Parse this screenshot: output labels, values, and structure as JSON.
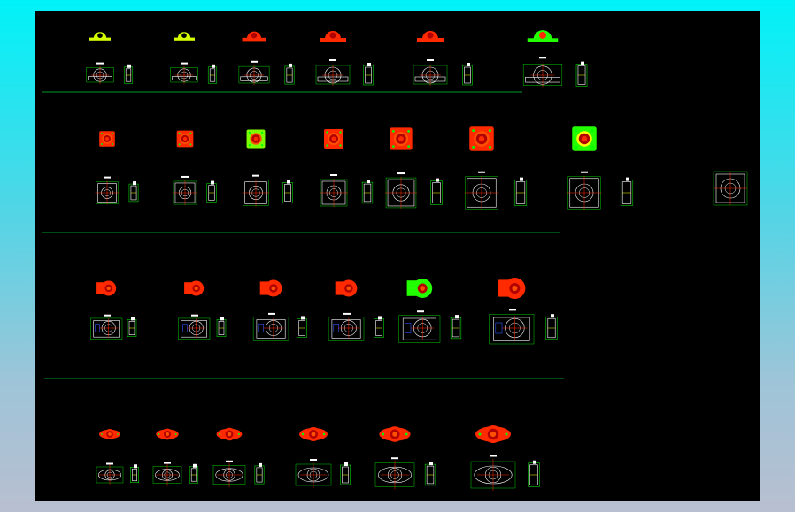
{
  "drawing": {
    "background": "#000000",
    "colors": {
      "red": "#ff2a00",
      "dark_red": "#b00000",
      "green": "#00ff00",
      "yellow_green": "#d4ff00",
      "lime": "#7cff00",
      "white": "#ffffff",
      "yellow": "#ffff00",
      "magenta": "#ff00ff",
      "blue": "#3355ff",
      "rule": "#00cc33"
    },
    "rows": [
      {
        "name": "pillow-block-row",
        "kind": "pillow",
        "items": [
          {
            "body_color": "#d4ff00",
            "bore_color": "#000000",
            "scale": 0.8
          },
          {
            "body_color": "#d4ff00",
            "bore_color": "#000000",
            "scale": 0.8
          },
          {
            "body_color": "#ff2a00",
            "bore_color": "#b00000",
            "scale": 0.9
          },
          {
            "body_color": "#ff2a00",
            "bore_color": "#b00000",
            "scale": 1.0
          },
          {
            "body_color": "#ff2a00",
            "bore_color": "#b00000",
            "scale": 1.0
          },
          {
            "body_color": "#22ff00",
            "bore_color": "#ff2a00",
            "scale": 1.15
          }
        ]
      },
      {
        "name": "square-flange-row",
        "kind": "square",
        "items": [
          {
            "body_color": "#ff2a00",
            "inner_color": "#ffcc00",
            "scale": 0.8
          },
          {
            "body_color": "#ff2a00",
            "inner_color": "#ffcc00",
            "scale": 0.85
          },
          {
            "body_color": "#7cff00",
            "inner_color": "#ff2a00",
            "scale": 0.95
          },
          {
            "body_color": "#ff2a00",
            "inner_color": "#ffcc00",
            "scale": 1.0
          },
          {
            "body_color": "#ff2a00",
            "inner_color": "#ff2a00",
            "scale": 1.15
          },
          {
            "body_color": "#ff2a00",
            "inner_color": "#ff2a00",
            "scale": 1.25
          },
          {
            "body_color": "#22ff00",
            "inner_color": "#ffff00",
            "scale": 1.25
          }
        ]
      },
      {
        "name": "take-up-row",
        "kind": "takeup",
        "items": [
          {
            "body_color": "#ff2a00",
            "scale": 0.85
          },
          {
            "body_color": "#ff2a00",
            "scale": 0.85
          },
          {
            "body_color": "#ff2a00",
            "scale": 0.95
          },
          {
            "body_color": "#ff2a00",
            "scale": 0.95
          },
          {
            "body_color": "#22ff00",
            "scale": 1.1
          },
          {
            "body_color": "#ff2a00",
            "scale": 1.2
          }
        ]
      },
      {
        "name": "oval-flange-row",
        "kind": "oval",
        "items": [
          {
            "body_color": "#ff2a00",
            "scale": 0.75
          },
          {
            "body_color": "#ff2a00",
            "scale": 0.8
          },
          {
            "body_color": "#ff2a00",
            "scale": 0.9
          },
          {
            "body_color": "#ff2a00",
            "scale": 1.0
          },
          {
            "body_color": "#ff2a00",
            "scale": 1.1
          },
          {
            "body_color": "#ff2a00",
            "scale": 1.25
          }
        ]
      }
    ]
  }
}
